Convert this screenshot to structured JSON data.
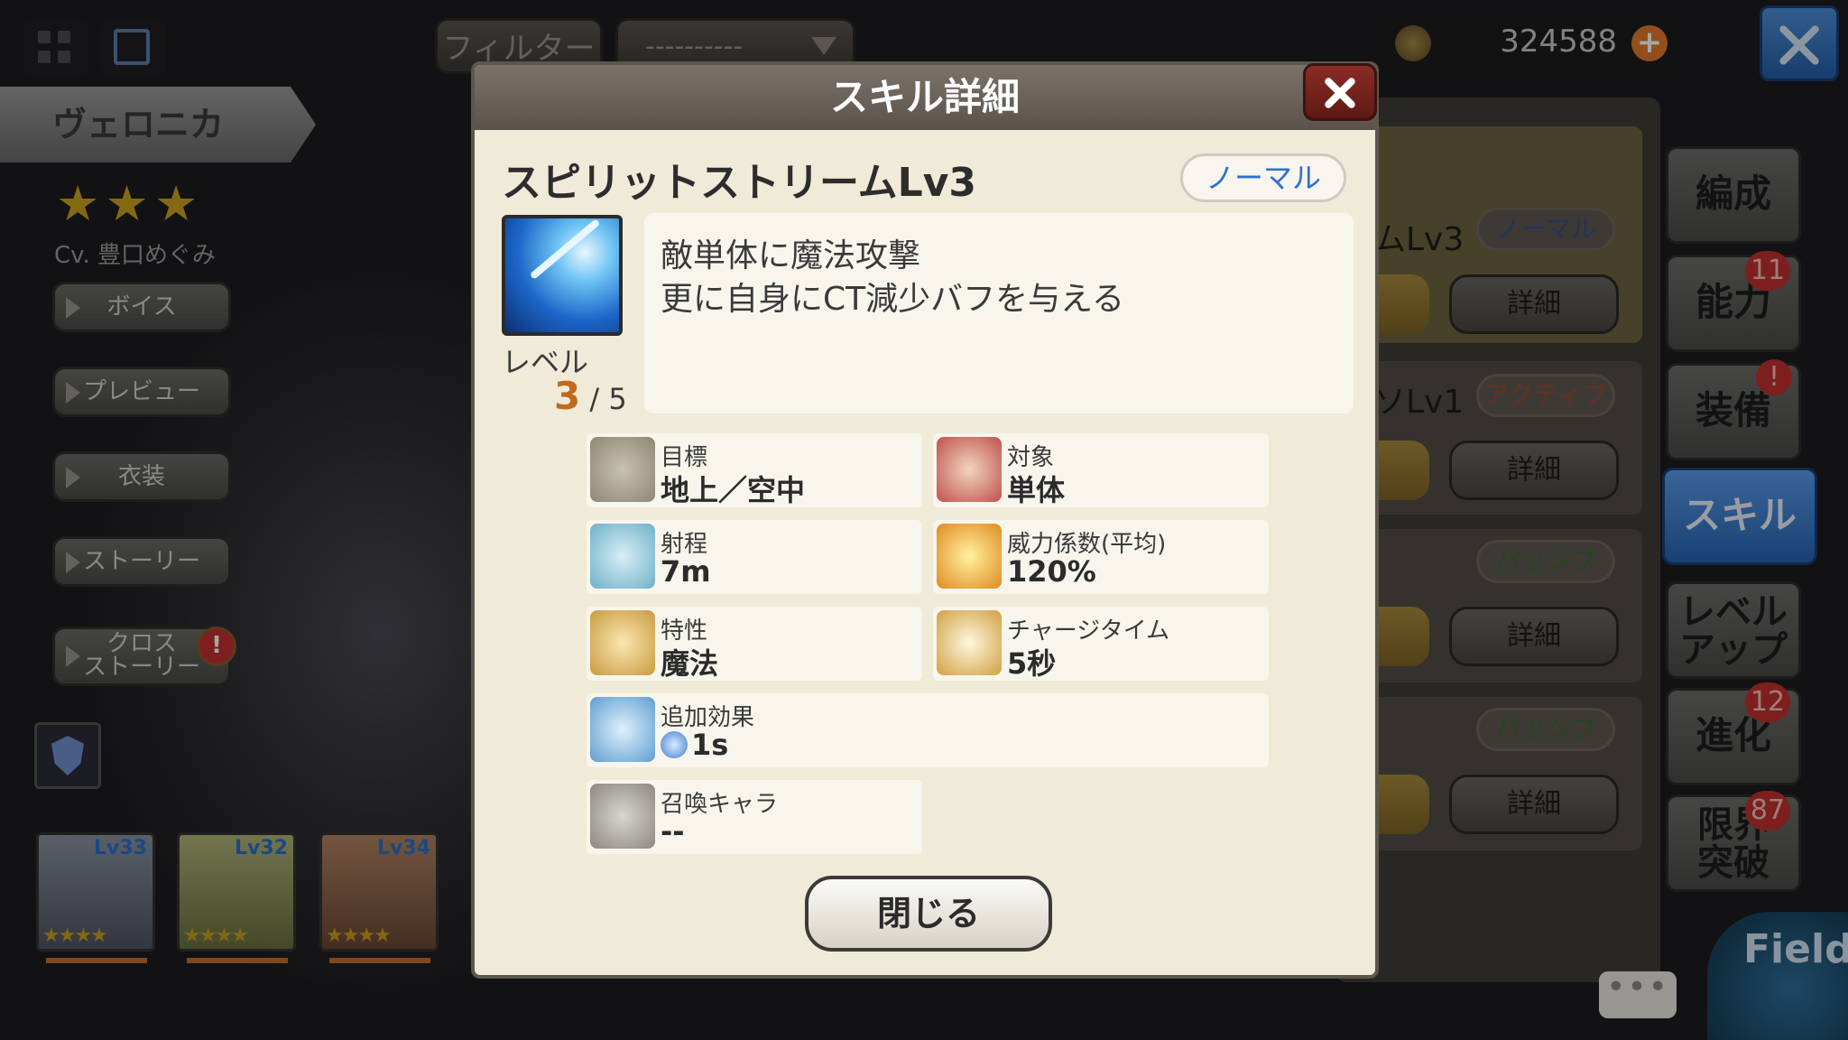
{
  "topbar": {
    "filter_label": "フィルター",
    "filter_select_value": "----------",
    "currency": "324588"
  },
  "character": {
    "name": "ヴェロニカ",
    "stars": "★★★",
    "cv": "Cv. 豊口めぐみ",
    "buttons": [
      "ボイス",
      "プレビュー",
      "衣装",
      "ストーリー",
      "クロス\nストーリー"
    ]
  },
  "party": [
    {
      "level": "Lv33",
      "stars": "★★★★",
      "color": "#7a8290"
    },
    {
      "level": "Lv32",
      "stars": "★★★★",
      "color": "#9aa06a"
    },
    {
      "level": "Lv34",
      "stars": "★★★★",
      "color": "#9a6f52"
    }
  ],
  "right_menu": {
    "formation": "編成",
    "ability": "能力",
    "ability_badge": "11",
    "equip": "装備",
    "equip_badge": "!",
    "skill": "スキル",
    "levelup_line1": "レベル",
    "levelup_line2": "アップ",
    "evolve": "進化",
    "evolve_badge": "12",
    "limit_line1": "限界",
    "limit_line2": "突破",
    "limit_badge": "87"
  },
  "skill_list": {
    "row1_title": "ムLv3",
    "row1_tag": "ノーマル",
    "row2_title": "ソLv1",
    "row2_tag": "アクティブ",
    "row3_tag": "パッシブ",
    "row4_tag": "パッシブ",
    "detail_label": "詳細",
    "field": "Field"
  },
  "modal": {
    "header": "スキル詳細",
    "skill_name": "スピリットストリームLv3",
    "type": "ノーマル",
    "level_label": "レベル",
    "level_current": "3",
    "level_sep": "/",
    "level_max": "5",
    "desc_line1": "敵単体に魔法攻撃",
    "desc_line2": "更に自身にCT減少バフを与える",
    "stats": {
      "target_label": "目標",
      "target_value": "地上／空中",
      "scope_label": "対象",
      "scope_value": "単体",
      "range_label": "射程",
      "range_value": "7m",
      "power_label": "威力係数(平均)",
      "power_value": "120%",
      "attribute_label": "特性",
      "attribute_value": "魔法",
      "charge_label": "チャージタイム",
      "charge_value": "5秒",
      "extra_label": "追加効果",
      "extra_value": "1s",
      "summon_label": "召喚キャラ",
      "summon_value": "--"
    },
    "close_label": "閉じる"
  },
  "colors": {
    "accent_blue": "#2f6fd0",
    "level_orange": "#c06a1e",
    "badge_red": "#c0302e"
  }
}
